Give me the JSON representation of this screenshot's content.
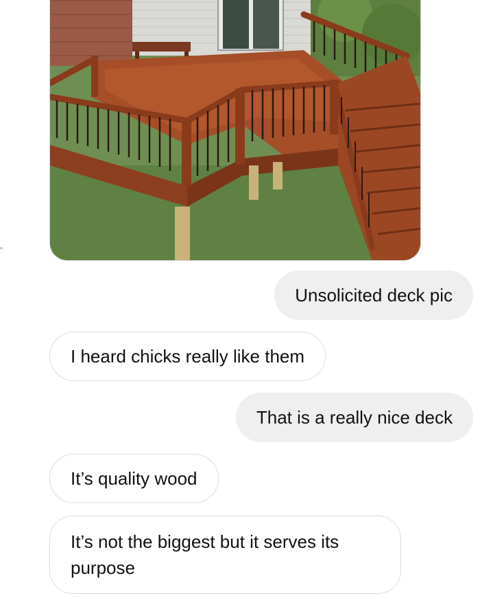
{
  "conversation": {
    "attachment": {
      "type": "photo",
      "description_icon": "deck-photo"
    },
    "messages": [
      {
        "from": "me",
        "text": "Unsolicited deck pic"
      },
      {
        "from": "them",
        "text": "I heard chicks really like them"
      },
      {
        "from": "me",
        "text": "That is a really nice deck"
      },
      {
        "from": "them",
        "text": "It’s quality wood"
      },
      {
        "from": "them",
        "text": "It’s not the biggest but it serves its purpose"
      }
    ]
  },
  "colors": {
    "sent_bubble": "#efefef",
    "received_bubble_border": "#dcdcdc",
    "text": "#111111"
  }
}
